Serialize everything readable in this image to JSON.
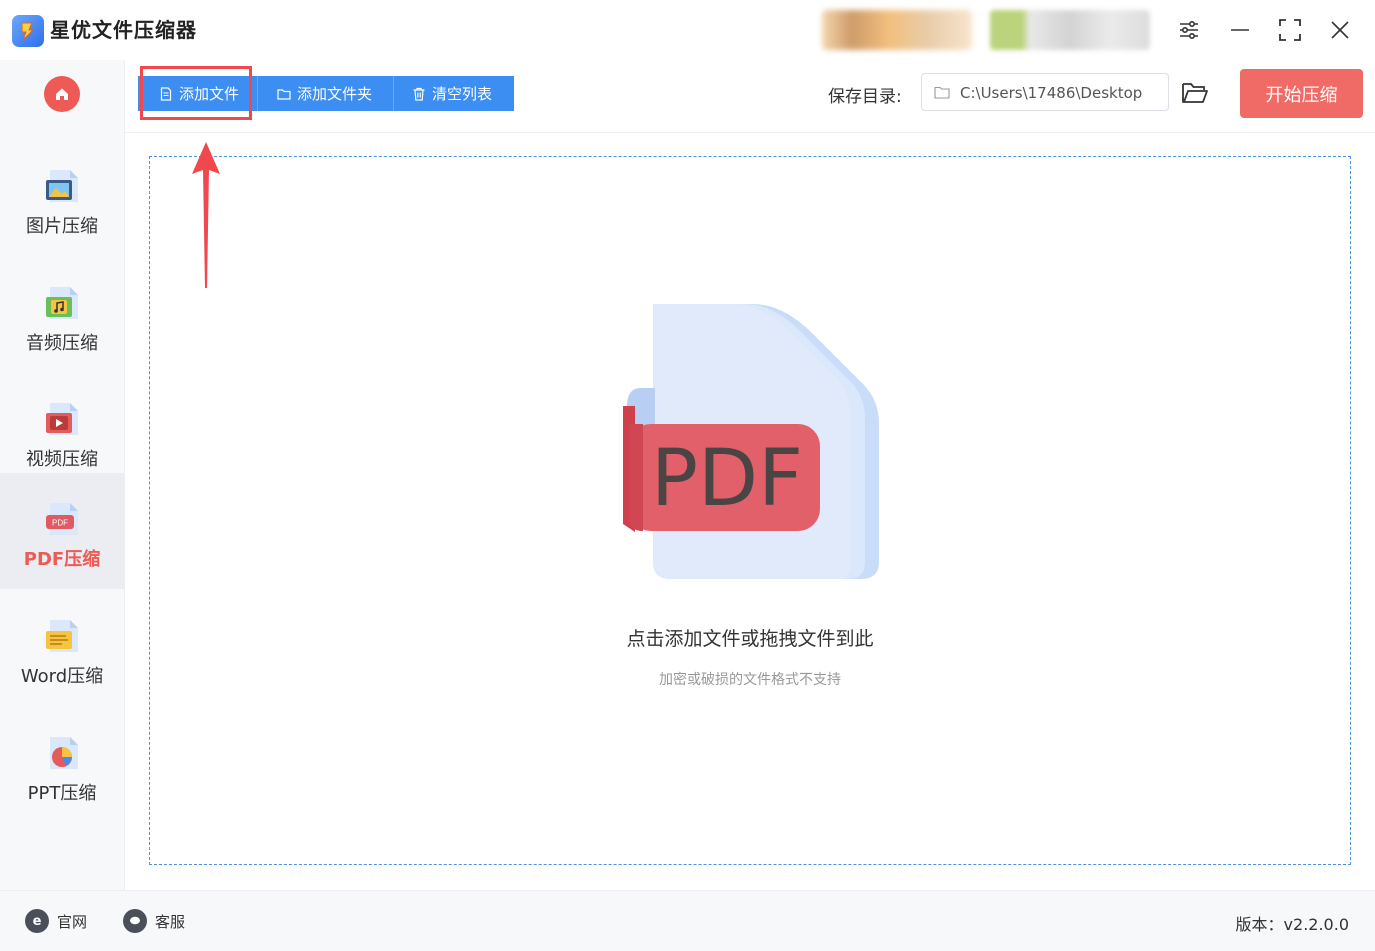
{
  "app": {
    "title": "星优文件压缩器"
  },
  "window": {
    "settings_icon": "sliders-icon",
    "minimize_icon": "minimize-icon",
    "maximize_icon": "maximize-icon",
    "close_icon": "close-icon"
  },
  "sidebar": {
    "home_icon": "home-icon",
    "items": [
      {
        "label": "图片压缩",
        "icon": "image-file-icon",
        "active": false
      },
      {
        "label": "音频压缩",
        "icon": "audio-file-icon",
        "active": false
      },
      {
        "label": "视频压缩",
        "icon": "video-file-icon",
        "active": false
      },
      {
        "label": "PDF压缩",
        "icon": "pdf-file-icon",
        "active": true
      },
      {
        "label": "Word压缩",
        "icon": "word-file-icon",
        "active": false
      },
      {
        "label": "PPT压缩",
        "icon": "ppt-file-icon",
        "active": false
      }
    ]
  },
  "toolbar": {
    "add_file": "添加文件",
    "add_folder": "添加文件夹",
    "clear_list": "清空列表",
    "save_dir_label": "保存目录:",
    "save_dir_value": "C:\\Users\\17486\\Desktop",
    "start_button": "开始压缩"
  },
  "dropzone": {
    "main_text": "点击添加文件或拖拽文件到此",
    "sub_text": "加密或破损的文件格式不支持",
    "illustration_label": "PDF"
  },
  "footer": {
    "website": "官网",
    "support": "客服",
    "version": "版本：v2.2.0.0"
  },
  "colors": {
    "accent_blue": "#3d8ef2",
    "accent_red": "#ee5a55",
    "start_button": "#f06a66"
  }
}
